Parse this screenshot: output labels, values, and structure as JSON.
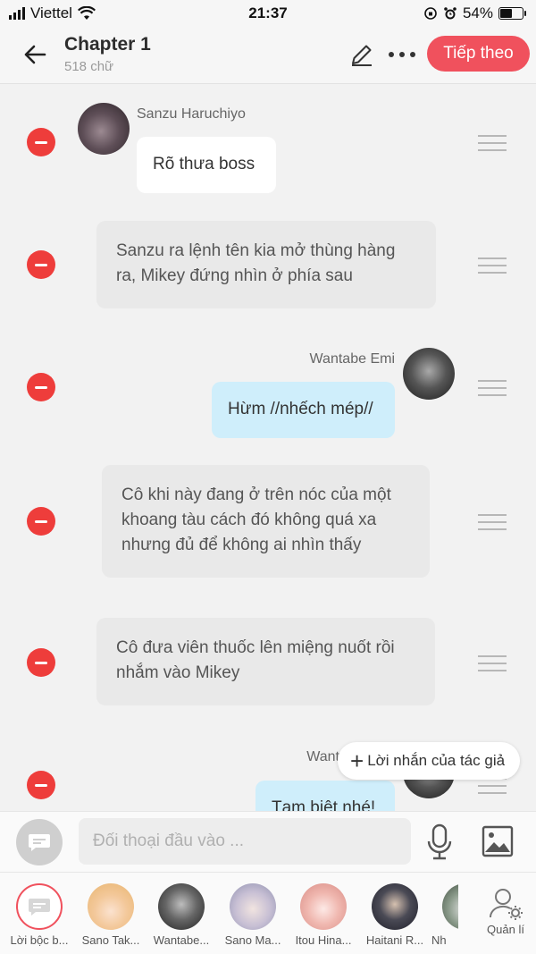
{
  "status_bar": {
    "carrier": "Viettel",
    "time": "21:37",
    "battery": "54%",
    "battery_level": 0.54
  },
  "header": {
    "title": "Chapter 1",
    "subtitle": "518 chữ",
    "next_label": "Tiếp theo"
  },
  "messages": [
    {
      "type": "character",
      "side": "left",
      "name": "Sanzu Haruchiyo",
      "text": "Rõ thưa boss"
    },
    {
      "type": "narration",
      "text": "Sanzu ra lệnh tên kia mở thùng hàng ra, Mikey đứng nhìn ở phía sau"
    },
    {
      "type": "character",
      "side": "right",
      "name": "Wantabe Emi",
      "text": "Hừm //nhếch mép//"
    },
    {
      "type": "narration",
      "text": "Cô khi này đang ở trên nóc của một khoang tàu cách đó không quá xa nhưng đủ để không ai nhìn thấy"
    },
    {
      "type": "narration",
      "text": "Cô đưa viên thuốc lên miệng nuốt rồi nhắm vào Mikey"
    },
    {
      "type": "character",
      "side": "right",
      "name": "Want",
      "text": "Tạm biệt nhé!"
    }
  ],
  "author_note": {
    "label": "Lời nhắn của tác giả"
  },
  "input": {
    "placeholder": "Đối thoại đầu vào ..."
  },
  "characters": [
    {
      "label": "Lời bộc b..."
    },
    {
      "label": "Sano Tak..."
    },
    {
      "label": "Wantabe..."
    },
    {
      "label": "Sano Ma..."
    },
    {
      "label": "Itou Hina..."
    },
    {
      "label": "Haitani R..."
    },
    {
      "label": "Nh"
    }
  ],
  "manage": {
    "label": "Quản lí"
  },
  "colors": {
    "accent": "#f0515d",
    "delete": "#ee3d3b",
    "bubble_blue": "#cfeefb",
    "narration": "#e9e9e9"
  }
}
